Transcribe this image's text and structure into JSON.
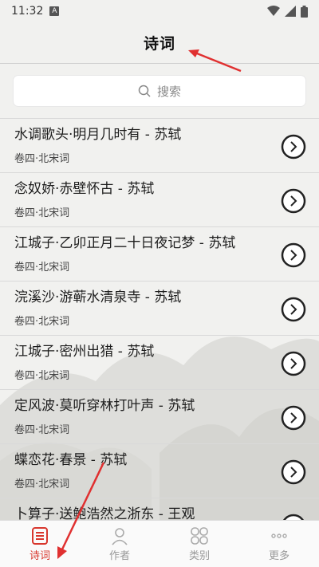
{
  "status": {
    "time": "11:32",
    "badge": "A"
  },
  "header": {
    "title": "诗词"
  },
  "search": {
    "placeholder": "搜索"
  },
  "poems": [
    {
      "title": "水调歌头·明月几时有 - 苏轼",
      "sub": "卷四·北宋词"
    },
    {
      "title": "念奴娇·赤壁怀古 - 苏轼",
      "sub": "卷四·北宋词"
    },
    {
      "title": "江城子·乙卯正月二十日夜记梦 - 苏轼",
      "sub": "卷四·北宋词"
    },
    {
      "title": "浣溪沙·游蕲水清泉寺 - 苏轼",
      "sub": "卷四·北宋词"
    },
    {
      "title": "江城子·密州出猎 - 苏轼",
      "sub": "卷四·北宋词"
    },
    {
      "title": "定风波·莫听穿林打叶声 - 苏轼",
      "sub": "卷四·北宋词"
    },
    {
      "title": "蝶恋花·春景 - 苏轼",
      "sub": "卷四·北宋词"
    },
    {
      "title": "卜算子·送鲍浩然之浙东 - 王观",
      "sub": ""
    }
  ],
  "tabs": [
    {
      "label": "诗词",
      "icon": "poem-icon",
      "active": true
    },
    {
      "label": "作者",
      "icon": "author-icon",
      "active": false
    },
    {
      "label": "类别",
      "icon": "category-icon",
      "active": false
    },
    {
      "label": "更多",
      "icon": "more-icon",
      "active": false
    }
  ],
  "colors": {
    "accent": "#d8372d",
    "annotation": "#e03030",
    "background": "#f1f1ef"
  }
}
